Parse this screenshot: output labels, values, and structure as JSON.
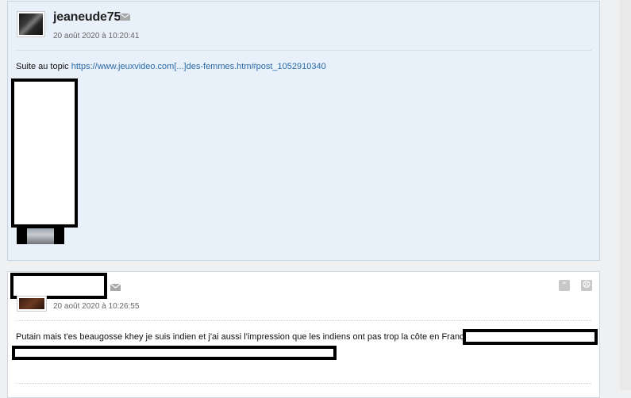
{
  "post1": {
    "username": "jeaneude75",
    "date": "20 août 2020 à 10:20:41",
    "message_prefix": "Suite au topic ",
    "message_link": "https://www.jeuxvideo.com[...]des-femmes.htm#post_1052910340",
    "avatar_icon": "user-avatar",
    "mail_icon": "envelope-icon"
  },
  "post2": {
    "date": "20 août 2020 à 10:26:55",
    "message": "Putain mais t'es beaugosse khey je suis indien et j'ai aussi l'impression que les indiens ont pas trop la côte en France.",
    "quote_icon": "quote-icon",
    "report_icon": "sad-face-icon",
    "quote_glyph": "“",
    "report_glyph": "☹"
  },
  "colors": {
    "post1_bg": "#e8f1fa",
    "post2_bg": "#ffffff",
    "link": "#2a6aa8",
    "redaction": "#000000"
  }
}
